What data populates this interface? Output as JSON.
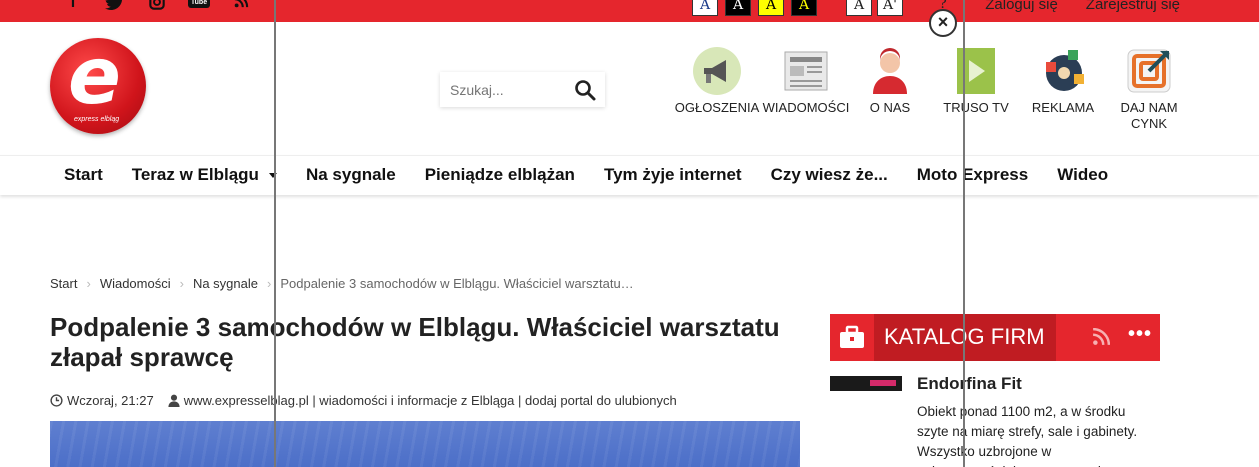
{
  "topbar": {
    "social": [
      "facebook-icon",
      "twitter-icon",
      "instagram-icon",
      "youtube-icon",
      "rss-icon"
    ],
    "font_buttons": [
      "A",
      "A",
      "A",
      "A"
    ],
    "font_size_buttons": [
      "A",
      "A'"
    ],
    "help_label": "?",
    "login": "Zaloguj się",
    "register": "Zarejestruj się"
  },
  "logo": {
    "letter": "e",
    "sub": "express elbląg"
  },
  "search": {
    "placeholder": "Szukaj..."
  },
  "nav_icons": [
    {
      "label": "OGŁOSZENIA",
      "icon": "megaphone-icon"
    },
    {
      "label": "WIADOMOŚCI",
      "icon": "newspaper-icon"
    },
    {
      "label": "O NAS",
      "icon": "person-icon"
    },
    {
      "label": "TRUSO TV",
      "icon": "play-icon"
    },
    {
      "label": "REKLAMA",
      "icon": "puzzle-icon"
    },
    {
      "label": "DAJ NAM CYNK",
      "icon": "target-icon"
    }
  ],
  "mainnav": [
    "Start",
    "Teraz w Elblągu",
    "Na sygnale",
    "Pieniądze elblążan",
    "Tym żyje internet",
    "Czy wiesz że...",
    "Moto Express",
    "Wideo"
  ],
  "breadcrumb": [
    "Start",
    "Wiadomości",
    "Na sygnale",
    "Podpalenie 3 samochodów w Elblągu. Właściciel warsztatu…"
  ],
  "article": {
    "title": "Podpalenie 3 samochodów w Elblągu. Właściciel warsztatu złapał sprawcę",
    "date": "Wczoraj, 21:27",
    "author": "www.expresselblag.pl | wiadomości i informacje z Elbląga | dodaj portal do ulubionych"
  },
  "sidebar": {
    "katalog_title": "KATALOG FIRM",
    "more": "•••",
    "firm_name": "Endorfina Fit",
    "firm_desc": "Obiekt ponad 1100 m2, a w środku szyte na miarę strefy, sale i gabinety. Wszystko uzbrojone w najnowocześniejsze maszyny i"
  },
  "close_label": "×",
  "colors": {
    "brand_red": "#e5262d",
    "dark_red": "#c01c22"
  }
}
